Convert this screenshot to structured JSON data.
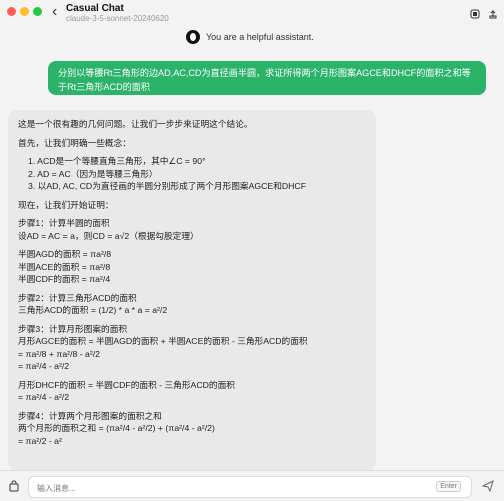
{
  "window": {
    "title": "Casual Chat",
    "subtitle": "claude-3-5-sonnet-20240620"
  },
  "system": {
    "label": "You are a helpful assistant."
  },
  "messages": {
    "user": "分别以等腰Rt三角形的边AD,AC,CD为直径画半圆，求证所得两个月形图案AGCE和DHCF的面积之和等于Rt三角形ACD的面积",
    "assistant": {
      "lines": [
        "这是一个很有趣的几何问题。让我们一步步来证明这个结论。",
        "首先，让我们明确一些概念：",
        "1. ACD是一个等腰直角三角形，其中∠C = 90°",
        "2. AD = AC（因为是等腰三角形）",
        "3. 以AD, AC, CD为直径画的半圆分别形成了两个月形图案AGCE和DHCF",
        "现在，让我们开始证明：",
        "步骤1：计算半圆的面积",
        "设AD = AC = a，则CD = a√2（根据勾股定理）",
        "半圆AGD的面积 = πa²/8",
        "半圆ACE的面积 = πa²/8",
        "半圆CDF的面积 = πa²/4",
        "步骤2：计算三角形ACD的面积",
        "三角形ACD的面积 = (1/2) * a * a = a²/2",
        "步骤3：计算月形图案的面积",
        "月形AGCE的面积 = 半圆AGD的面积 + 半圆ACE的面积 - 三角形ACD的面积",
        "= πa²/8 + πa²/8 - a²/2",
        "= πa²/4 - a²/2",
        "月形DHCF的面积 = 半圆CDF的面积 - 三角形ACD的面积",
        "= πa²/4 - a²/2",
        "步骤4：计算两个月形图案的面积之和",
        "两个月形的面积之和 = (πa²/4 - a²/2) + (πa²/4 - a²/2)",
        "= πa²/2 - a²"
      ]
    }
  },
  "input": {
    "placeholder": "输入消息...",
    "enter_label": "Enter"
  }
}
